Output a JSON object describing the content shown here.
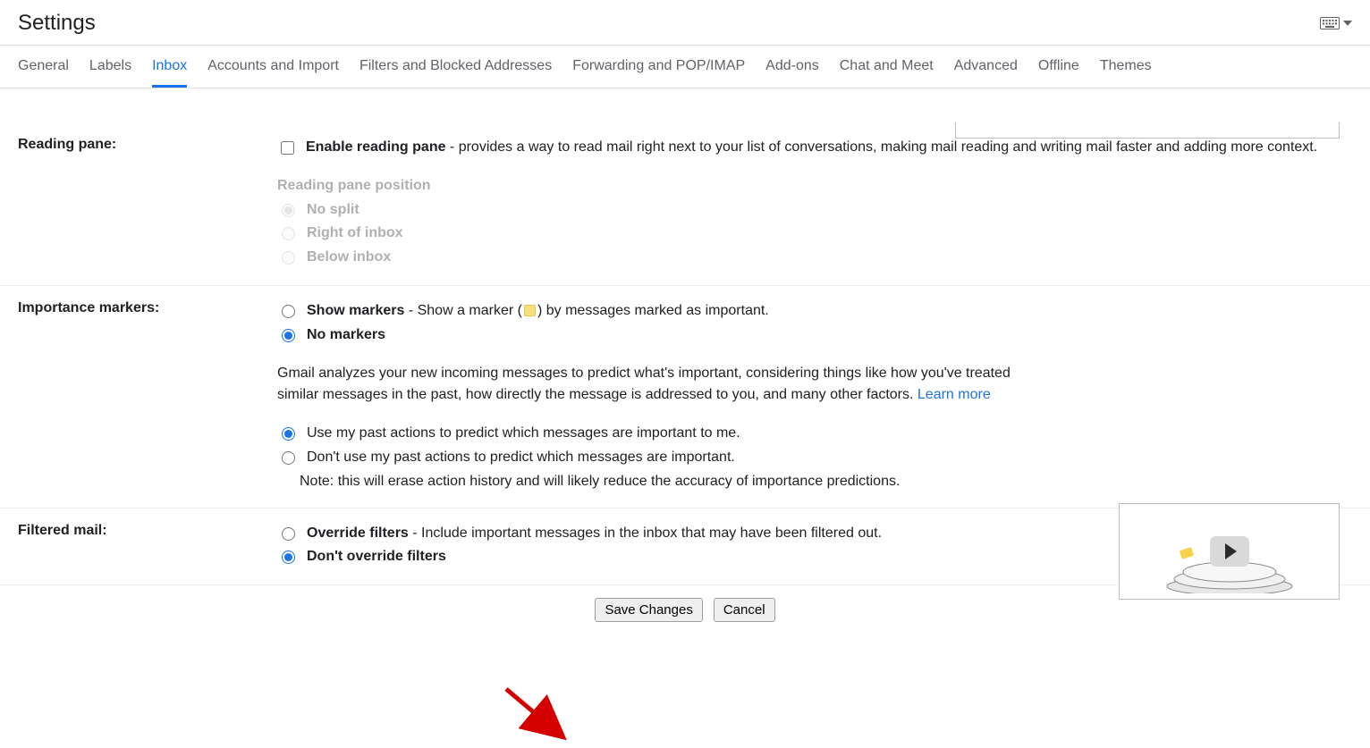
{
  "title": "Settings",
  "tabs": [
    "General",
    "Labels",
    "Inbox",
    "Accounts and Import",
    "Filters and Blocked Addresses",
    "Forwarding and POP/IMAP",
    "Add-ons",
    "Chat and Meet",
    "Advanced",
    "Offline",
    "Themes"
  ],
  "active_tab_index": 2,
  "reading_pane": {
    "label": "Reading pane:",
    "enable_label": "Enable reading pane",
    "enable_desc": " - provides a way to read mail right next to your list of conversations, making mail reading and writing mail faster and adding more context.",
    "enabled": false,
    "position_heading": "Reading pane position",
    "options": [
      "No split",
      "Right of inbox",
      "Below inbox"
    ],
    "position_selected_index": 0
  },
  "importance": {
    "label": "Importance markers:",
    "show_label": "Show markers",
    "show_desc_pre": " - Show a marker (",
    "show_desc_post": ") by messages marked as important.",
    "no_label": "No markers",
    "selected_marker": "no",
    "explain": "Gmail analyzes your new incoming messages to predict what's important, considering things like how you've treated similar messages in the past, how directly the message is addressed to you, and many other factors. ",
    "learn_more": "Learn more",
    "predict_use": "Use my past actions to predict which messages are important to me.",
    "predict_dont": "Don't use my past actions to predict which messages are important.",
    "predict_note": "Note: this will erase action history and will likely reduce the accuracy of importance predictions.",
    "predict_selected": "use"
  },
  "filtered": {
    "label": "Filtered mail:",
    "override_label": "Override filters",
    "override_desc": " - Include important messages in the inbox that may have been filtered out.",
    "dont_label": "Don't override filters",
    "selected": "dont"
  },
  "buttons": {
    "save": "Save Changes",
    "cancel": "Cancel"
  }
}
